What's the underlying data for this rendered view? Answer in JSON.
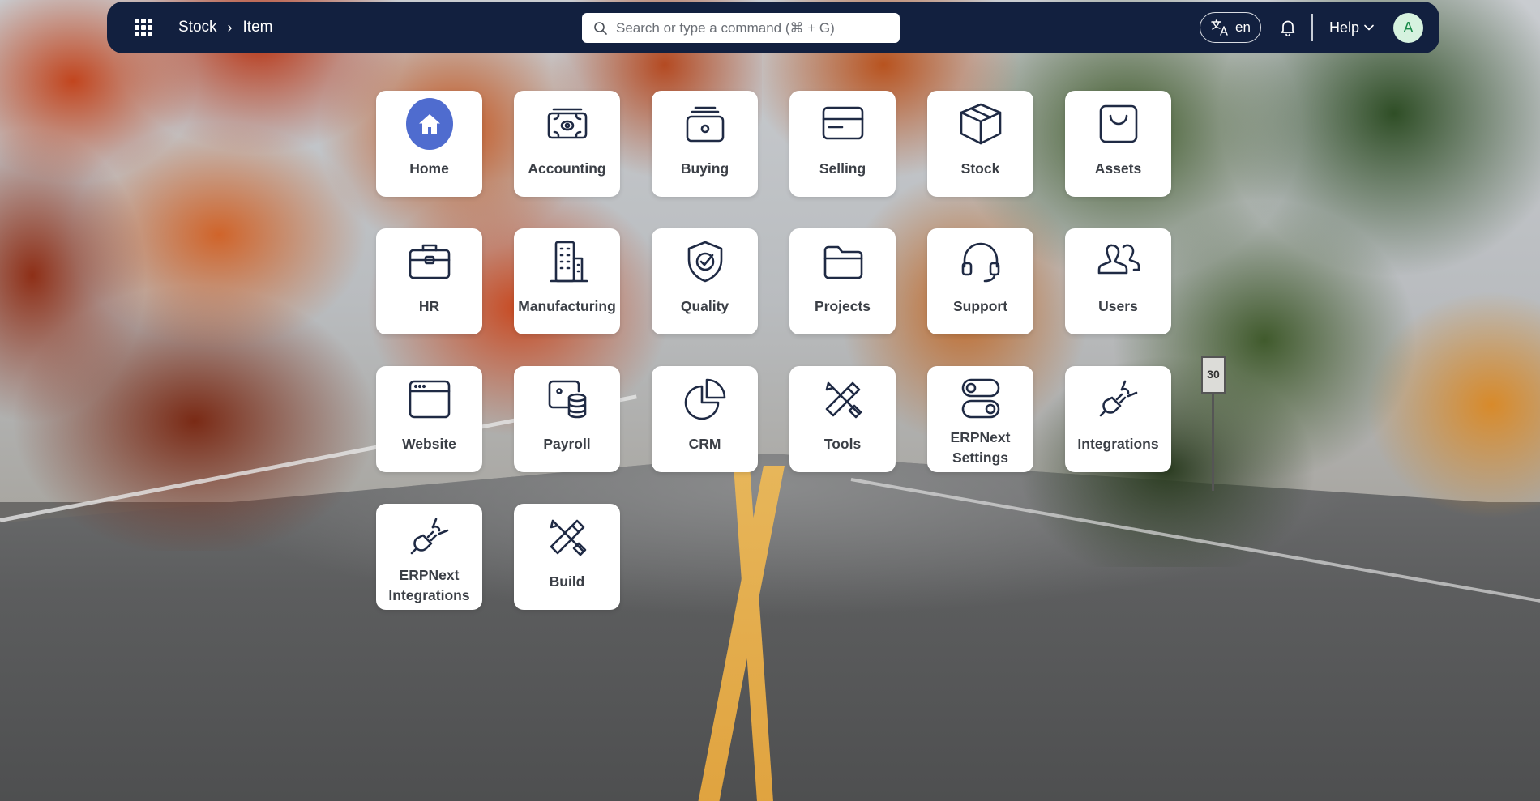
{
  "navbar": {
    "apps_icon": "grid-apps-icon",
    "breadcrumb": [
      "Stock",
      "Item"
    ],
    "breadcrumb_separator": "›",
    "search_placeholder": "Search or type a command (⌘ + G)",
    "language": "en",
    "help_label": "Help",
    "avatar_initial": "A",
    "colors": {
      "navbar_bg": "#12203f",
      "avatar_bg": "#d6f2df",
      "avatar_fg": "#1a8a4a",
      "home_accent": "#4f6ccf"
    }
  },
  "apps": [
    {
      "label": "Home",
      "icon": "home-icon"
    },
    {
      "label": "Accounting",
      "icon": "money-icon"
    },
    {
      "label": "Buying",
      "icon": "shopping-bag-icon"
    },
    {
      "label": "Selling",
      "icon": "card-icon"
    },
    {
      "label": "Stock",
      "icon": "box-icon"
    },
    {
      "label": "Assets",
      "icon": "bag-icon"
    },
    {
      "label": "HR",
      "icon": "briefcase-icon"
    },
    {
      "label": "Manufacturing",
      "icon": "building-icon"
    },
    {
      "label": "Quality",
      "icon": "shield-check-icon"
    },
    {
      "label": "Projects",
      "icon": "folder-icon"
    },
    {
      "label": "Support",
      "icon": "headset-icon"
    },
    {
      "label": "Users",
      "icon": "users-icon"
    },
    {
      "label": "Website",
      "icon": "browser-window-icon"
    },
    {
      "label": "Payroll",
      "icon": "payroll-icon"
    },
    {
      "label": "CRM",
      "icon": "pie-chart-icon"
    },
    {
      "label": "Tools",
      "icon": "tools-icon"
    },
    {
      "label": "ERPNext Settings",
      "icon": "toggles-icon"
    },
    {
      "label": "Integrations",
      "icon": "plug-icon"
    },
    {
      "label": "ERPNext Integrations",
      "icon": "plug-icon"
    },
    {
      "label": "Build",
      "icon": "hammer-icon"
    }
  ],
  "background": {
    "sign_text": "30"
  }
}
